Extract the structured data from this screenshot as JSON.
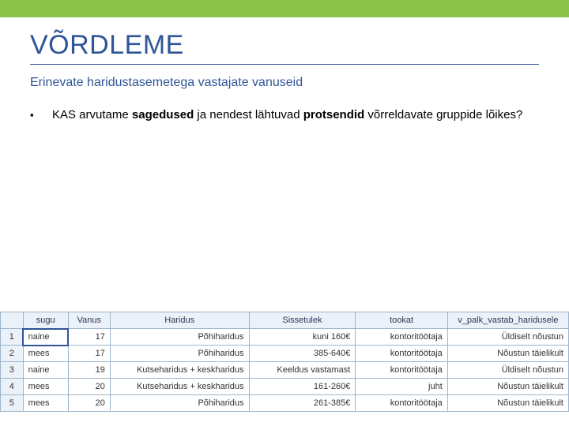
{
  "topbar": {},
  "title": "VÕRDLEME",
  "subtitle": "Erinevate haridustasemetega vastajate vanuseid",
  "bullet": {
    "prefix": "KAS arvutame ",
    "bold1": "sagedused",
    "mid": "  ja nendest lähtuvad ",
    "bold2": "protsendid",
    "suffix": "  võrreldavate gruppide lõikes?"
  },
  "table": {
    "headers": [
      "sugu",
      "Vanus",
      "Haridus",
      "Sissetulek",
      "tookat",
      "v_palk_vastab_haridusele"
    ],
    "rows": [
      {
        "n": "1",
        "sugu": "naine",
        "vanus": "17",
        "haridus": "Põhiharidus",
        "sissetulek": "kuni 160€",
        "tookat": "kontoritöötaja",
        "vpalk": "Üldiselt nõustun"
      },
      {
        "n": "2",
        "sugu": "mees",
        "vanus": "17",
        "haridus": "Põhiharidus",
        "sissetulek": "385-640€",
        "tookat": "kontoritöötaja",
        "vpalk": "Nõustun täielikult"
      },
      {
        "n": "3",
        "sugu": "naine",
        "vanus": "19",
        "haridus": "Kutseharidus + keskharidus",
        "sissetulek": "Keeldus vastamast",
        "tookat": "kontoritöötaja",
        "vpalk": "Üldiselt nõustun"
      },
      {
        "n": "4",
        "sugu": "mees",
        "vanus": "20",
        "haridus": "Kutseharidus + keskharidus",
        "sissetulek": "161-260€",
        "tookat": "juht",
        "vpalk": "Nõustun täielikult"
      },
      {
        "n": "5",
        "sugu": "mees",
        "vanus": "20",
        "haridus": "Põhiharidus",
        "sissetulek": "261-385€",
        "tookat": "kontoritöötaja",
        "vpalk": "Nõustun täielikult"
      }
    ]
  }
}
